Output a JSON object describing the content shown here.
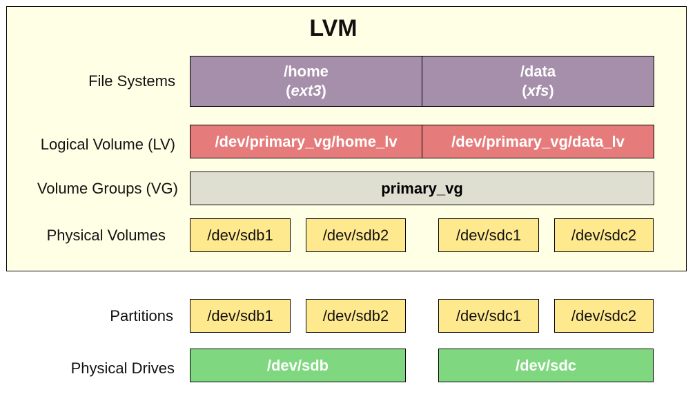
{
  "title": "LVM",
  "rows": {
    "file_systems": {
      "label": "File Systems",
      "items": [
        {
          "path": "/home",
          "fstype": "ext3"
        },
        {
          "path": "/data",
          "fstype": "xfs"
        }
      ]
    },
    "logical_volumes": {
      "label": "Logical Volume (LV)",
      "items": [
        "/dev/primary_vg/home_lv",
        "/dev/primary_vg/data_lv"
      ]
    },
    "volume_groups": {
      "label": "Volume Groups (VG)",
      "items": [
        "primary_vg"
      ]
    },
    "physical_volumes": {
      "label": "Physical Volumes",
      "items": [
        "/dev/sdb1",
        "/dev/sdb2",
        "/dev/sdc1",
        "/dev/sdc2"
      ]
    },
    "partitions": {
      "label": "Partitions",
      "items": [
        "/dev/sdb1",
        "/dev/sdb2",
        "/dev/sdc1",
        "/dev/sdc2"
      ]
    },
    "physical_drives": {
      "label": "Physical Drives",
      "items": [
        "/dev/sdb",
        "/dev/sdc"
      ]
    }
  },
  "colors": {
    "lvm_background": "#ffffe6",
    "file_system": "#a58faa",
    "logical_volume": "#e57c7b",
    "volume_group": "#dfdfd1",
    "partition": "#ffe98f",
    "drive": "#7fd87f"
  }
}
